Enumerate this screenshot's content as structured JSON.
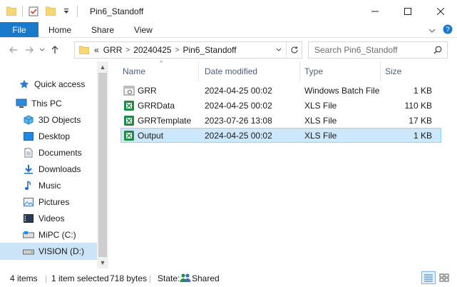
{
  "window": {
    "title": "Pin6_Standoff",
    "minimize_icon": "minimize-icon",
    "maximize_icon": "maximize-icon",
    "close_icon": "close-icon"
  },
  "ribbon": {
    "tabs": [
      "File",
      "Home",
      "Share",
      "View"
    ]
  },
  "address": {
    "overflow": "«",
    "crumbs": [
      "GRR",
      "20240425",
      "Pin6_Standoff"
    ]
  },
  "search": {
    "placeholder": "Search Pin6_Standoff"
  },
  "nav": {
    "items": [
      {
        "label": "Quick access",
        "icon": "star-icon"
      },
      {
        "label": "This PC",
        "icon": "computer-icon"
      },
      {
        "label": "3D Objects",
        "icon": "3d-objects-icon"
      },
      {
        "label": "Desktop",
        "icon": "desktop-icon"
      },
      {
        "label": "Documents",
        "icon": "documents-icon"
      },
      {
        "label": "Downloads",
        "icon": "downloads-icon"
      },
      {
        "label": "Music",
        "icon": "music-icon"
      },
      {
        "label": "Pictures",
        "icon": "pictures-icon"
      },
      {
        "label": "Videos",
        "icon": "videos-icon"
      },
      {
        "label": "MiPC (C:)",
        "icon": "drive-icon"
      },
      {
        "label": "VISION (D:)",
        "icon": "drive-icon"
      }
    ]
  },
  "columns": [
    "Name",
    "Date modified",
    "Type",
    "Size"
  ],
  "files": [
    {
      "name": "GRR",
      "date": "2024-04-25 00:02",
      "type": "Windows Batch File",
      "size": "1 KB",
      "icon": "batch-file-icon"
    },
    {
      "name": "GRRData",
      "date": "2024-04-25 00:02",
      "type": "XLS File",
      "size": "110 KB",
      "icon": "xls-file-icon"
    },
    {
      "name": "GRRTemplate",
      "date": "2023-07-26 13:08",
      "type": "XLS File",
      "size": "17 KB",
      "icon": "xls-file-icon"
    },
    {
      "name": "Output",
      "date": "2024-04-25 00:02",
      "type": "XLS File",
      "size": "1 KB",
      "icon": "xls-file-icon"
    }
  ],
  "status": {
    "item_count": "4 items",
    "selected": "1 item selected",
    "selected_size": "718 bytes",
    "state_label": "State:",
    "state_value": "Shared"
  },
  "colors": {
    "accent": "#1979ca",
    "selection": "#cce8ff",
    "xls_green": "#1e8c45",
    "folder_yellow": "#f8d775"
  }
}
